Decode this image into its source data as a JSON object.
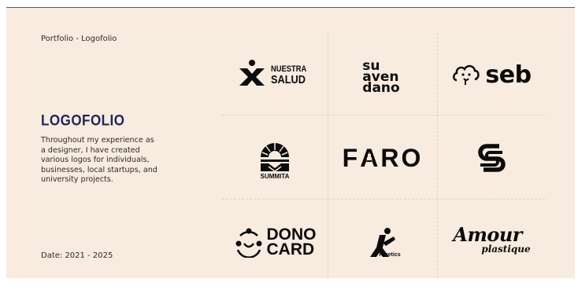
{
  "page": {
    "breadcrumb": "Portfolio - Logofolio",
    "title": "LOGOFOLIO",
    "description": "Throughout my experience as a designer, I have created various logos for individuals, businesses, local startups, and university projects.",
    "date": "Date: 2021 - 2025"
  },
  "colors": {
    "background": "#f8ebdf",
    "title": "#1f2557",
    "logo": "#0c0c0c"
  },
  "logos": {
    "nuestra_salud": {
      "line1": "NUESTRA",
      "line2": "SALUD",
      "icon": "x-figure-icon"
    },
    "suavendano": {
      "line1": "su",
      "line2": "aven",
      "line3": "dano",
      "icon": "wordmark"
    },
    "seb": {
      "text": "seb",
      "icon": "cloud-face-icon"
    },
    "summita": {
      "text": "SUMMITA",
      "icon": "sunrise-mountain-icon"
    },
    "faro": {
      "letter_f": "F",
      "letter_a": "A",
      "letters_ro": "RO",
      "icon": "lighthouse-icon"
    },
    "cs_monogram": {
      "icon": "cs-monogram-icon"
    },
    "donocard": {
      "line1": "DONO",
      "line2": "CARD",
      "icon": "people-circle-icon"
    },
    "kinetics": {
      "text": "Kinetics",
      "icon": "runner-k-icon"
    },
    "amour": {
      "line1": "Amour",
      "line2": "plastique",
      "icon": "rose-icon"
    }
  }
}
